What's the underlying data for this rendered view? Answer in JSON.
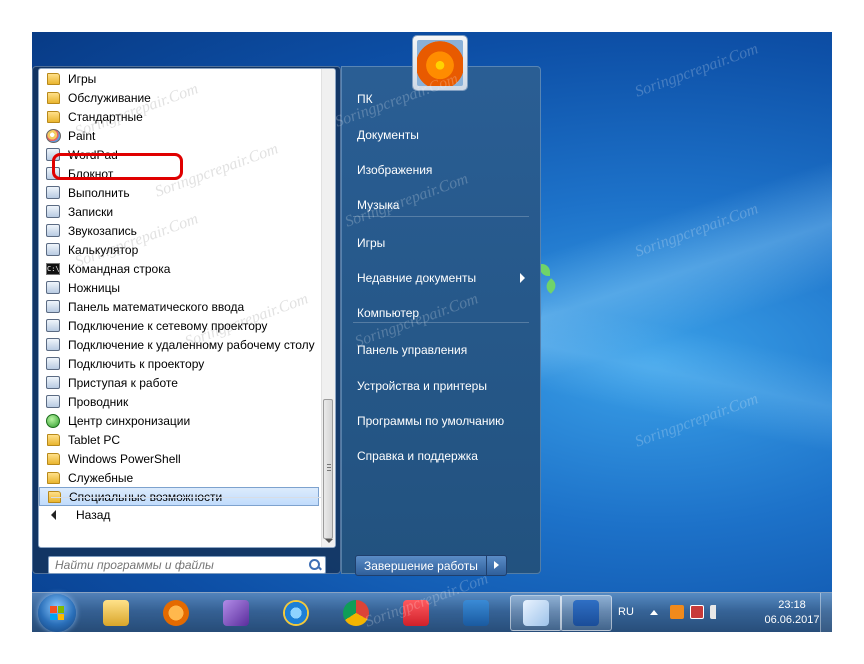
{
  "programs": [
    {
      "label": "Игры",
      "icon": "folder-icon"
    },
    {
      "label": "Обслуживание",
      "icon": "folder-icon"
    },
    {
      "label": "Стандартные",
      "icon": "folder-icon"
    },
    {
      "label": "Paint",
      "icon": "paint-icon"
    },
    {
      "label": "WordPad",
      "icon": "wordpad-icon"
    },
    {
      "label": "Блокнот",
      "icon": "notepad-icon"
    },
    {
      "label": "Выполнить",
      "icon": "run-icon"
    },
    {
      "label": "Записки",
      "icon": "sticky-notes-icon"
    },
    {
      "label": "Звукозапись",
      "icon": "sound-recorder-icon"
    },
    {
      "label": "Калькулятор",
      "icon": "calculator-icon"
    },
    {
      "label": "Командная строка",
      "icon": "command-prompt-icon"
    },
    {
      "label": "Ножницы",
      "icon": "snipping-tool-icon"
    },
    {
      "label": "Панель математического ввода",
      "icon": "math-input-icon"
    },
    {
      "label": "Подключение к сетевому проектору",
      "icon": "network-projector-icon"
    },
    {
      "label": "Подключение к удаленному рабочему столу",
      "icon": "remote-desktop-icon"
    },
    {
      "label": "Подключить к проектору",
      "icon": "projector-icon"
    },
    {
      "label": "Приступая к работе",
      "icon": "getting-started-icon"
    },
    {
      "label": "Проводник",
      "icon": "explorer-icon"
    },
    {
      "label": "Центр синхронизации",
      "icon": "sync-center-icon"
    },
    {
      "label": "Tablet PC",
      "icon": "folder-icon"
    },
    {
      "label": "Windows PowerShell",
      "icon": "folder-icon"
    },
    {
      "label": "Служебные",
      "icon": "folder-icon"
    },
    {
      "label": "Специальные возможности",
      "icon": "folder-icon",
      "selected": true
    }
  ],
  "back_label": "Назад",
  "search": {
    "placeholder": "Найти программы и файлы"
  },
  "right_menu": {
    "items": [
      {
        "label": "ПК"
      },
      {
        "label": "Документы"
      },
      {
        "label": "Изображения"
      },
      {
        "label": "Музыка"
      },
      {
        "label": "Игры"
      },
      {
        "label": "Недавние документы",
        "has_submenu": true
      },
      {
        "label": "Компьютер"
      },
      {
        "label": "Панель управления"
      },
      {
        "label": "Устройства и принтеры"
      },
      {
        "label": "Программы по умолчанию"
      },
      {
        "label": "Справка и поддержка"
      }
    ],
    "shutdown_label": "Завершение работы"
  },
  "taskbar": {
    "apps": [
      "explorer-icon",
      "media-player-icon",
      "visual-studio-icon",
      "ie-icon",
      "chrome-icon",
      "vivaldi-icon",
      "maxthon-icon",
      "paint-icon",
      "word-icon"
    ],
    "language": "RU",
    "time": "23:18",
    "date": "06.06.2017"
  },
  "watermark": "Soringpcrepair.Com",
  "colors": {
    "highlight": "#e00000",
    "selection": "#c1dcfc",
    "right_pane": "#2a5e94"
  }
}
